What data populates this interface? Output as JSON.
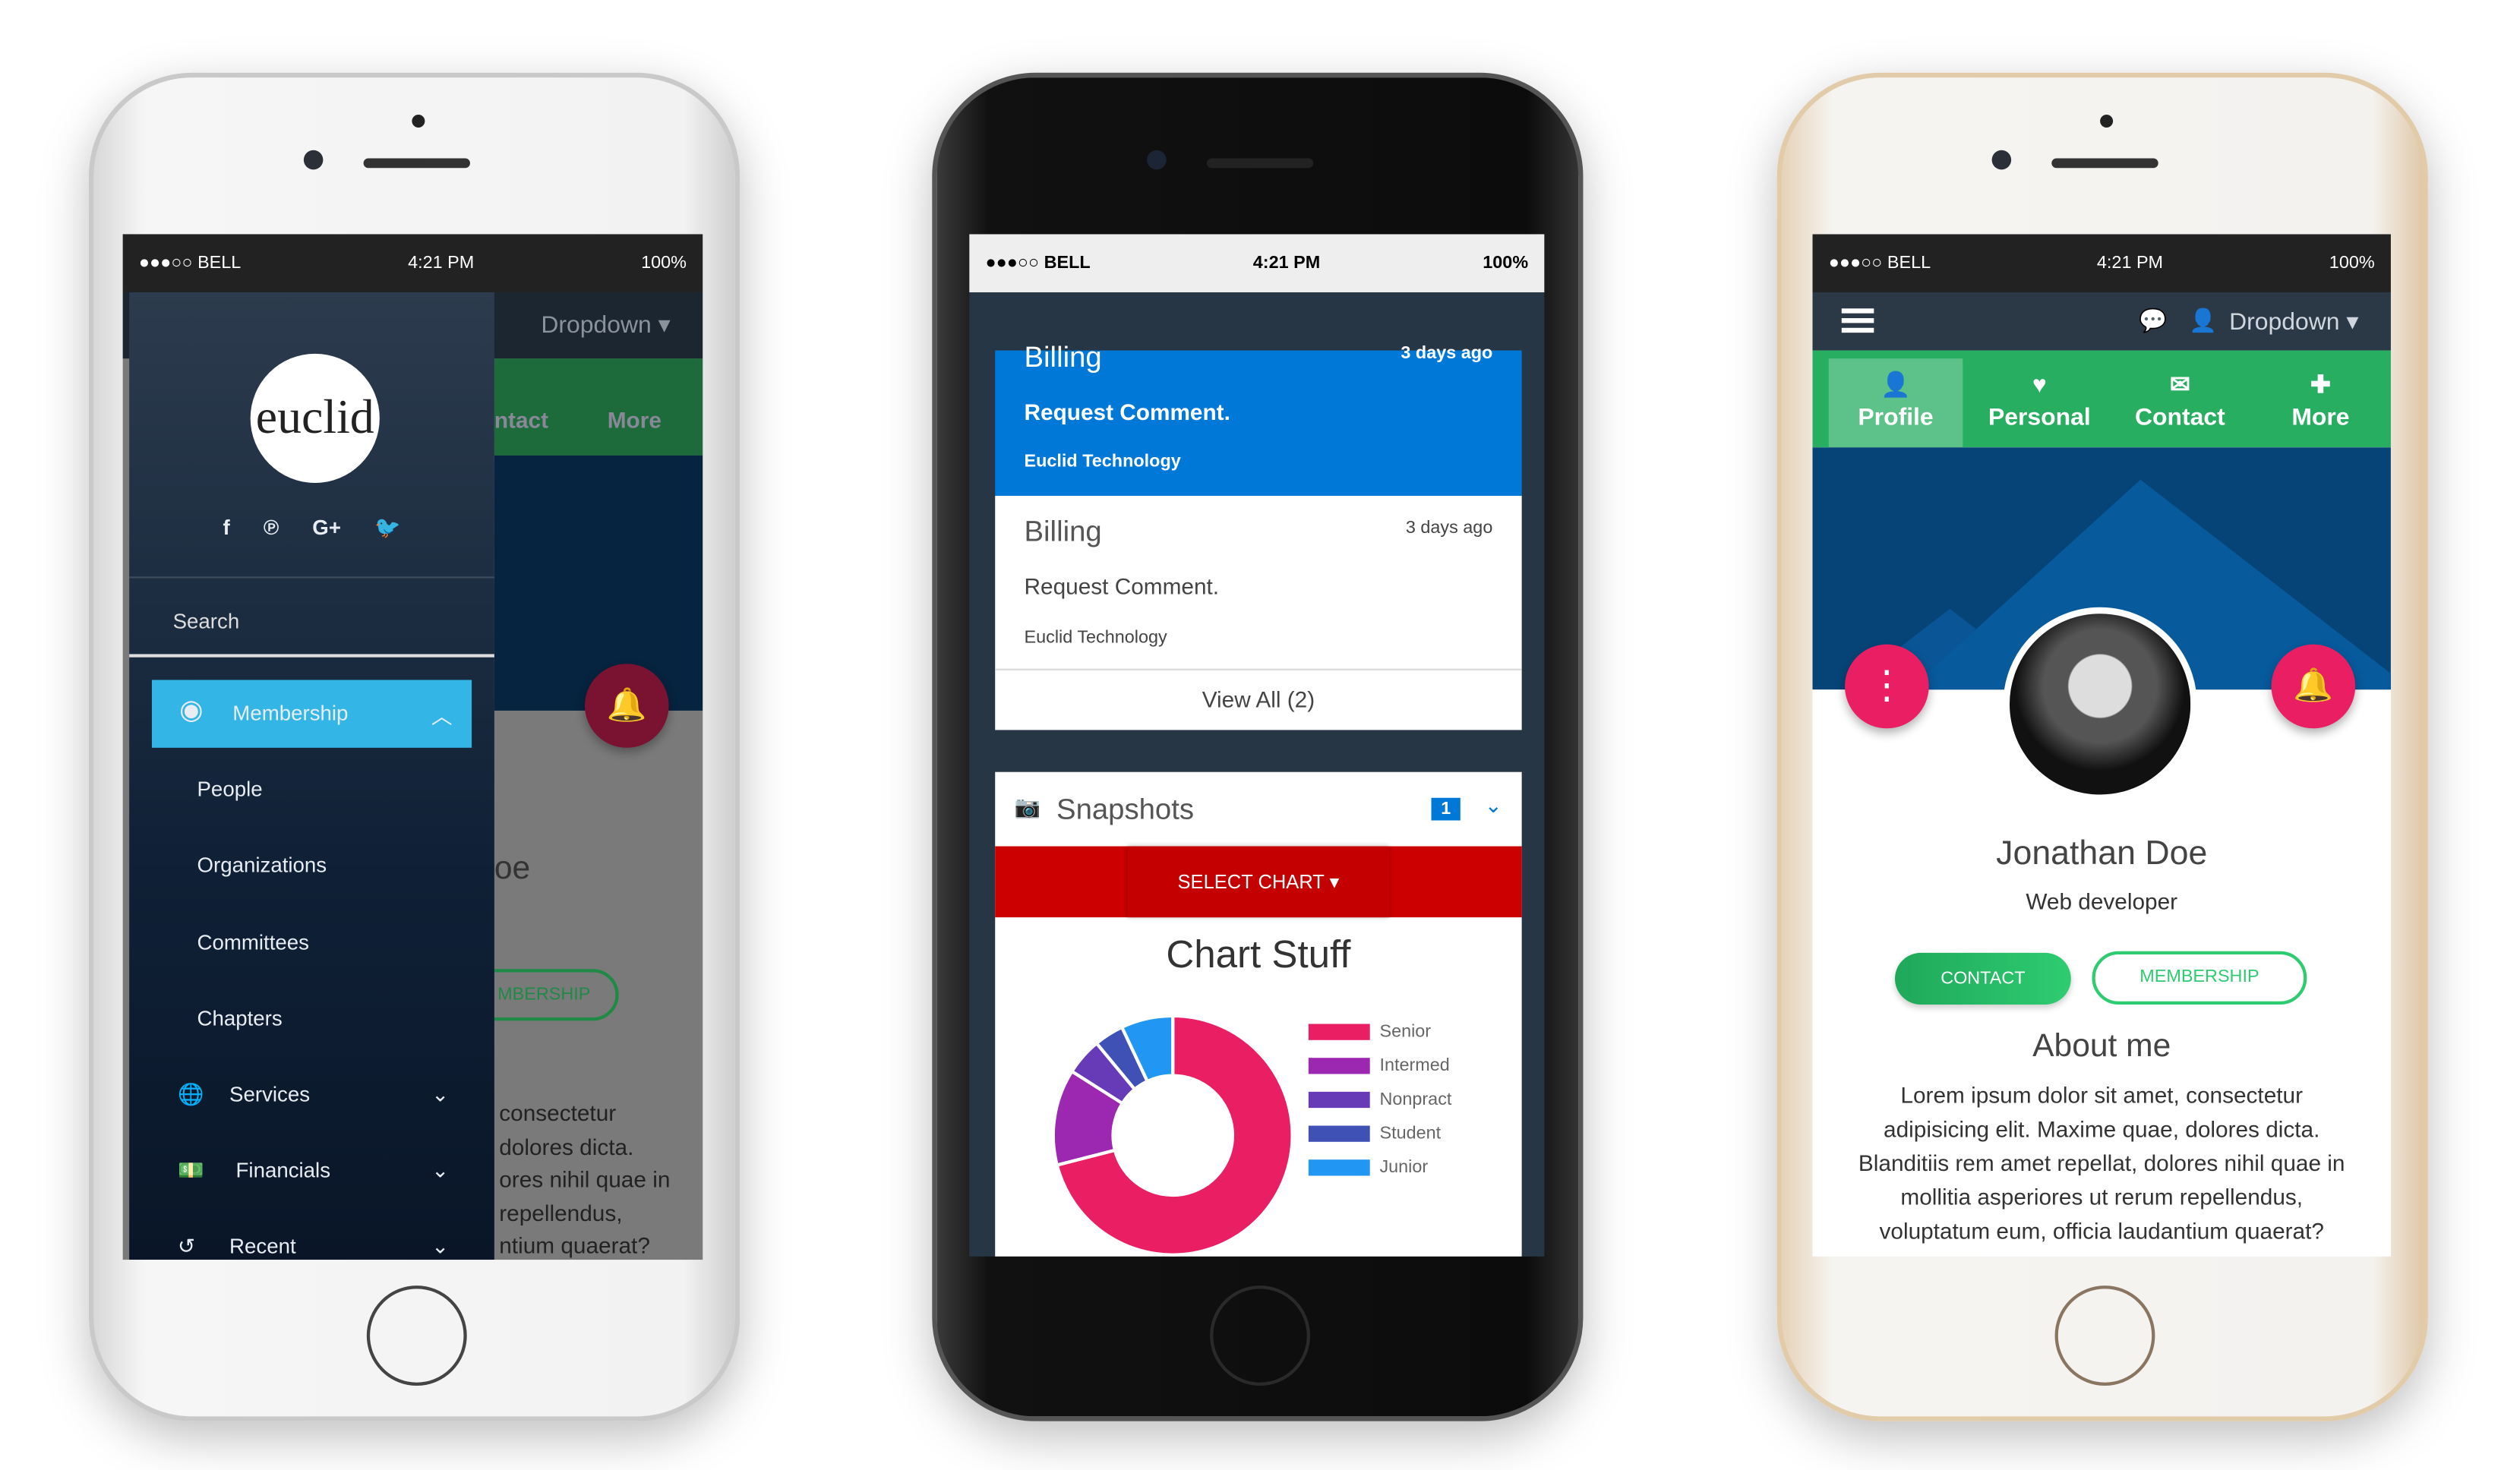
{
  "status": {
    "carrier": "●●●○○ BELL",
    "time": "4:21 PM",
    "battery": "100%"
  },
  "navbar": {
    "dropdown": "Dropdown ▾"
  },
  "profile_tabs": [
    {
      "label": "Profile",
      "icon": "user-icon"
    },
    {
      "label": "Personal",
      "icon": "heart-icon"
    },
    {
      "label": "Contact",
      "icon": "envelope-icon"
    },
    {
      "label": "More",
      "icon": "plus-icon"
    }
  ],
  "drawer": {
    "logo": "euclid",
    "social": [
      "facebook-icon",
      "pinterest-icon",
      "google-plus-icon",
      "twitter-icon"
    ],
    "search_placeholder": "Search",
    "membership": "Membership",
    "sub_items": [
      "People",
      "Organizations",
      "Committees",
      "Chapters"
    ],
    "sections": [
      {
        "label": "Services",
        "icon": "globe-icon"
      },
      {
        "label": "Financials",
        "icon": "money-icon"
      },
      {
        "label": "Recent",
        "icon": "history-icon"
      }
    ]
  },
  "left_bg": {
    "name_fragment": "oe",
    "membership_fragment": "MBERSHIP",
    "contact_fragment": "ntact",
    "more": "More",
    "lines": [
      "consectetur",
      "dolores dicta.",
      "ores nihil quae in",
      "repellendus,",
      "ntium quaerat?"
    ]
  },
  "notifications": [
    {
      "title": "Billing",
      "time": "3 days ago",
      "message": "Request Comment.",
      "org": "Euclid Technology",
      "active": true
    },
    {
      "title": "Billing",
      "time": "3 days ago",
      "message": "Request Comment.",
      "org": "Euclid Technology",
      "active": false
    }
  ],
  "view_all": "View All (2)",
  "snapshots": {
    "title": "Snapshots",
    "badge": "1",
    "select_chart": "SELECT CHART ▾"
  },
  "chart_data": {
    "type": "pie",
    "title": "Chart Stuff",
    "donut": true,
    "legend": "right",
    "categories": [
      "Senior",
      "Intermed",
      "Nonpract",
      "Student",
      "Junior"
    ],
    "values": [
      71,
      13,
      5,
      4,
      7
    ],
    "colors": [
      "#e91e63",
      "#9c27b0",
      "#673ab7",
      "#3f51b5",
      "#2196f3"
    ]
  },
  "profile": {
    "name": "Jonathan Doe",
    "role": "Web developer",
    "contact_btn": "CONTACT",
    "membership_btn": "MEMBERSHIP",
    "about_title": "About me",
    "about": "Lorem ipsum dolor sit amet, consectetur adipisicing elit. Maxime quae, dolores dicta. Blanditiis rem amet repellat, dolores nihil quae in mollitia asperiores ut rerum repellendus, voluptatum eum, officia laudantium quaerat?"
  },
  "colors": {
    "navbar": "#2b3947",
    "green": "#27ae60",
    "pink": "#e91e63",
    "blue": "#0078d7",
    "red": "#cc0000",
    "drawer_active": "#33b5e5"
  }
}
